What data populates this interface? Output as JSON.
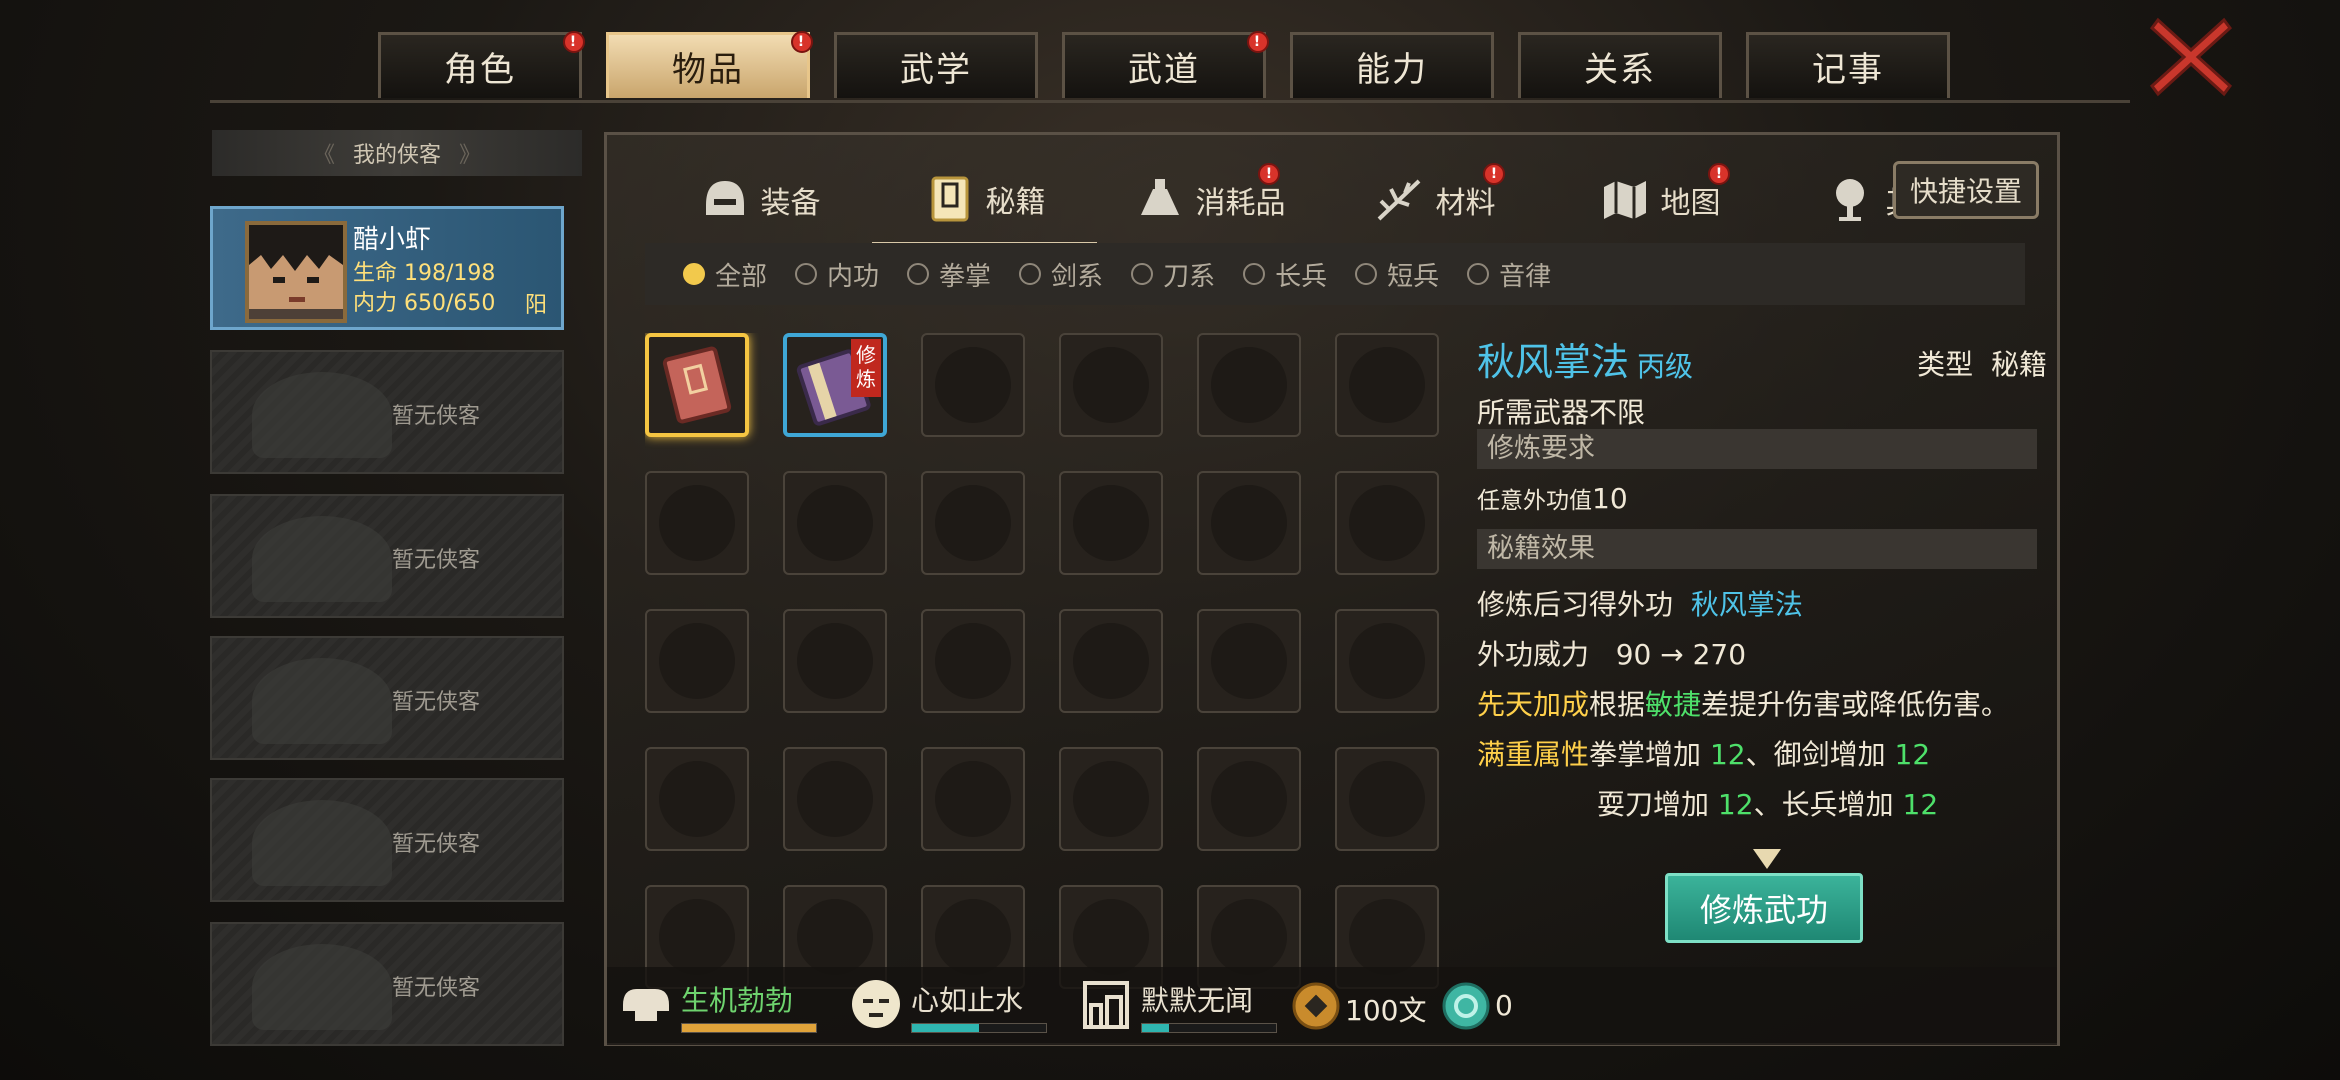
{
  "top_tabs": [
    {
      "label": "角色",
      "badge": "!"
    },
    {
      "label": "物品",
      "badge": "!",
      "active": true
    },
    {
      "label": "武学",
      "badge": ""
    },
    {
      "label": "武道",
      "badge": "!"
    },
    {
      "label": "能力",
      "badge": ""
    },
    {
      "label": "关系",
      "badge": ""
    },
    {
      "label": "记事",
      "badge": ""
    }
  ],
  "roster": {
    "header": "我的侠客",
    "hero": {
      "name": "醋小虾",
      "hp": "生命 198/198",
      "mp": "内力 650/650",
      "tag": "阳"
    },
    "empty_label": "暂无侠客"
  },
  "sub_tabs": [
    {
      "label": "装备",
      "icon": "helmet-icon",
      "badge": ""
    },
    {
      "label": "秘籍",
      "icon": "book-icon",
      "badge": "",
      "active": true
    },
    {
      "label": "消耗品",
      "icon": "potion-icon",
      "badge": "!"
    },
    {
      "label": "材料",
      "icon": "herb-icon",
      "badge": "!"
    },
    {
      "label": "地图",
      "icon": "map-icon",
      "badge": "!"
    },
    {
      "label": "其他",
      "icon": "lamp-icon",
      "badge": "!"
    }
  ],
  "shortcut_button": "快捷设置",
  "filters": [
    {
      "label": "全部",
      "on": true
    },
    {
      "label": "内功",
      "on": false
    },
    {
      "label": "拳掌",
      "on": false
    },
    {
      "label": "剑系",
      "on": false
    },
    {
      "label": "刀系",
      "on": false
    },
    {
      "label": "长兵",
      "on": false
    },
    {
      "label": "短兵",
      "on": false
    },
    {
      "label": "音律",
      "on": false
    }
  ],
  "items": [
    {
      "icon": "red-book-icon",
      "selected": true
    },
    {
      "icon": "scroll-book-icon",
      "tag": "修炼"
    }
  ],
  "detail": {
    "title": "秋风掌法",
    "grade": "丙级",
    "type_label": "类型",
    "type_value": "秘籍",
    "weapon_label": "所需武器",
    "weapon_value": "不限",
    "req_section": "修炼要求",
    "req_label": "任意外功值",
    "req_value": "10",
    "effect_section": "秘籍效果",
    "learn_label": "修炼后习得外功",
    "learn_value": "秋风掌法",
    "power_label": "外功威力",
    "power_value": "90 → 270",
    "innate_label": "先天加成",
    "innate_pre": "根据",
    "innate_attr": "敏捷",
    "innate_post": "差提升伤害或降低伤害。",
    "full_label": "满重属性",
    "bonus1_name": "拳掌增加",
    "bonus1_val": "12",
    "bonus2_name": "御剑增加",
    "bonus2_val": "12",
    "bonus3_name": "耍刀增加",
    "bonus3_val": "12",
    "bonus4_name": "长兵增加",
    "bonus4_val": "12",
    "sep": "、",
    "train_button": "修炼武功"
  },
  "status_bar": {
    "stat1": {
      "label": "生机勃勃",
      "icon": "muscle-icon",
      "level": 1.0,
      "color": "#e0a33a"
    },
    "stat2": {
      "label": "心如止水",
      "icon": "calm-face-icon",
      "level": 0.5,
      "color": "#2fb5b0"
    },
    "stat3": {
      "label": "默默无闻",
      "icon": "building-icon",
      "level": 0.2,
      "color": "#2fb5b0"
    },
    "money": "100文",
    "gems": "0"
  },
  "colors": {
    "accent_cyan": "#4fc3e8",
    "accent_gold": "#ffd04a",
    "accent_green": "#4ee06a"
  }
}
